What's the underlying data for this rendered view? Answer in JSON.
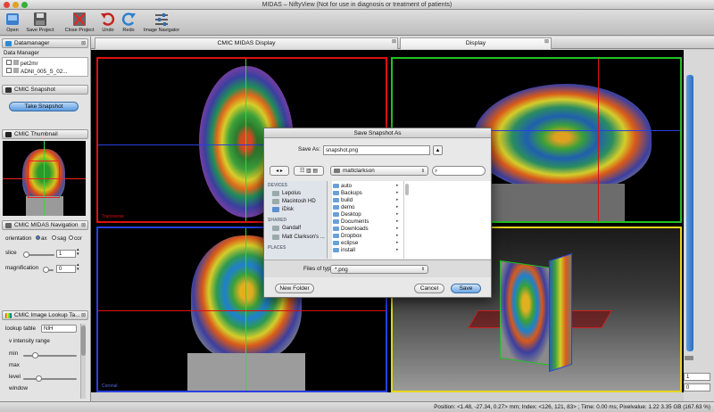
{
  "window": {
    "title": "MIDAS – NiftyView (Not for use in diagnosis or treatment of patients)"
  },
  "toolbar": {
    "items": [
      {
        "label": "Open",
        "icon": "open-icon"
      },
      {
        "label": "Save Project",
        "icon": "save-icon"
      },
      {
        "label": "Close Project",
        "icon": "close-project-icon"
      },
      {
        "label": "Undo",
        "icon": "undo-icon"
      },
      {
        "label": "Redo",
        "icon": "redo-icon"
      },
      {
        "label": "Image Navigator",
        "icon": "sliders-icon"
      }
    ]
  },
  "datamanager": {
    "title": "Datamanager",
    "header": "Data Manager",
    "items": [
      "pet2mr",
      "ADNI_005_S_02..."
    ]
  },
  "snapshot": {
    "title": "CMIC Snapshot",
    "button": "Take Snapshot"
  },
  "thumbnail": {
    "title": "CMIC Thumbnail"
  },
  "navigation": {
    "title": "CMIC MIDAS Navigation",
    "orientation_label": "orientation",
    "options": [
      "ax",
      "sag",
      "cor"
    ],
    "slice_label": "slice",
    "slice_value": "1",
    "magnification_label": "magnification",
    "magnification_value": "0"
  },
  "lookup": {
    "title": "CMIC Image Lookup Ta...",
    "table_label": "lookup table",
    "table_value": "NIH",
    "range_label": "intensity range",
    "min_label": "min",
    "max_label": "max",
    "level_label": "level",
    "window_label": "window"
  },
  "tabs": [
    {
      "label": "CMIC MIDAS Display"
    },
    {
      "label": "Display"
    }
  ],
  "views": {
    "axial_label": "Transverse",
    "coronal_label": "Coronal"
  },
  "dialog": {
    "title": "Save Snapshot As",
    "save_as_label": "Save As:",
    "filename": "snapshot.png",
    "location": "mattclarkson",
    "search_placeholder": "",
    "sidebar": {
      "devices_header": "DEVICES",
      "devices": [
        "Lepolus",
        "Macintosh HD",
        "iDisk"
      ],
      "shared_header": "SHARED",
      "shared": [
        "Gandalf",
        "Matt Clarkson's ..."
      ],
      "places_header": "PLACES"
    },
    "files": [
      "auto",
      "Backups",
      "build",
      "demo",
      "Desktop",
      "Documents",
      "Downloads",
      "Dropbox",
      "eclipse",
      "install"
    ],
    "filetype_label": "Files of type:",
    "filetype_value": "*.png",
    "new_folder": "New Folder",
    "cancel": "Cancel",
    "save": "Save"
  },
  "right_panel": {
    "value1": "1",
    "value2": "0"
  },
  "status": {
    "text": "Position: <1.48, -27.34, 0.27> mm; Index: <126, 121, 83> ; Time: 0.00 ms; Pixelvalue: 1.22    3.35 GB (167.63 %)"
  }
}
